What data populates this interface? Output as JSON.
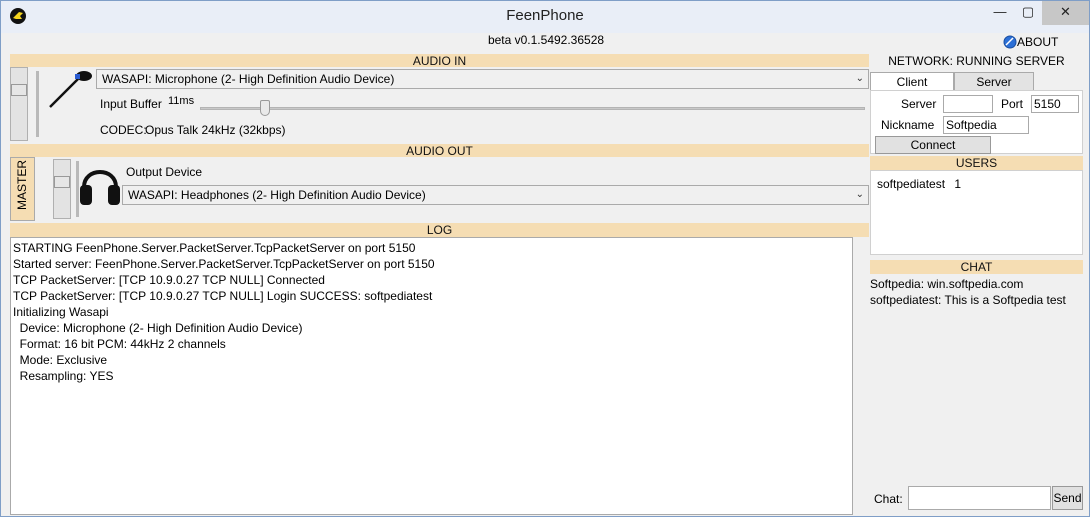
{
  "window": {
    "title": "FeenPhone",
    "subtitle": "beta v0.1.5492.36528",
    "about_label": "ABOUT",
    "min_glyph": "—",
    "max_glyph": "▢",
    "close_glyph": "✕"
  },
  "audio_in": {
    "header": "AUDIO IN",
    "device": "WASAPI: Microphone (2- High Definition Audio Device)",
    "input_buffer_label": "Input Buffer",
    "input_buffer_value": "11ms",
    "codec_label": "CODEC:",
    "codec_value": "Opus Talk 24kHz (32kbps)",
    "input_buffer_fraction": 0.09
  },
  "audio_out": {
    "header": "AUDIO OUT",
    "master_tab": "MASTER",
    "output_device_label": "Output Device",
    "device": "WASAPI: Headphones (2- High Definition Audio Device)"
  },
  "log": {
    "header": "LOG",
    "lines": [
      "STARTING FeenPhone.Server.PacketServer.TcpPacketServer on port 5150",
      "Started server: FeenPhone.Server.PacketServer.TcpPacketServer on port 5150",
      "TCP PacketServer: [TCP 10.9.0.27 TCP NULL] Connected",
      "TCP PacketServer: [TCP 10.9.0.27 TCP NULL] Login SUCCESS: softpediatest",
      "Initializing Wasapi",
      "  Device: Microphone (2- High Definition Audio Device)",
      "  Format: 16 bit PCM: 44kHz 2 channels",
      "  Mode: Exclusive",
      "  Resampling: YES"
    ]
  },
  "network": {
    "header": "NETWORK: RUNNING SERVER",
    "tabs": [
      {
        "label": "Client"
      },
      {
        "label": "Server"
      }
    ],
    "server_label": "Server",
    "server_value": "",
    "port_label": "Port",
    "port_value": "5150",
    "nickname_label": "Nickname",
    "nickname_value": "Softpedia",
    "connect_label": "Connect"
  },
  "users": {
    "header": "USERS",
    "list": [
      {
        "name": "softpediatest",
        "count": "1"
      }
    ]
  },
  "chat": {
    "header": "CHAT",
    "messages": [
      "Softpedia: win.softpedia.com",
      "softpediatest: This is a Softpedia test,"
    ],
    "input_label": "Chat:",
    "input_value": "",
    "send_label": "Send"
  }
}
